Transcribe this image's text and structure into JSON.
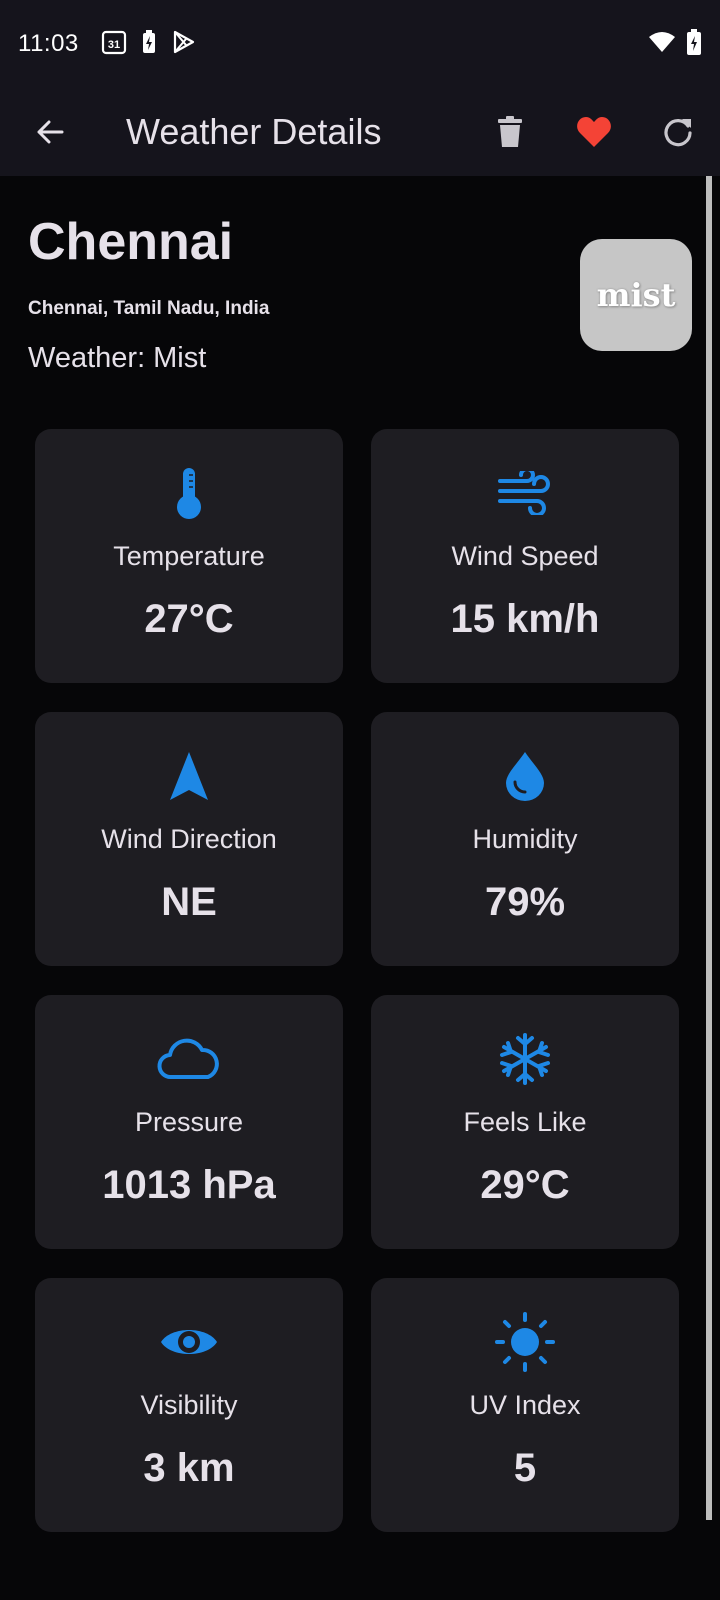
{
  "status_bar": {
    "time": "11:03",
    "calendar_day": "31"
  },
  "app_bar": {
    "title": "Weather Details"
  },
  "location": {
    "city": "Chennai",
    "full": "Chennai, Tamil Nadu, India",
    "weather_prefix": "Weather:",
    "weather": "Mist",
    "badge_text": "mist"
  },
  "cards": [
    {
      "label": "Temperature",
      "value": "27°C",
      "icon": "thermometer-icon"
    },
    {
      "label": "Wind Speed",
      "value": "15 km/h",
      "icon": "wind-icon"
    },
    {
      "label": "Wind Direction",
      "value": "NE",
      "icon": "navigation-arrow-icon"
    },
    {
      "label": "Humidity",
      "value": "79%",
      "icon": "water-drop-icon"
    },
    {
      "label": "Pressure",
      "value": "1013 hPa",
      "icon": "cloud-icon"
    },
    {
      "label": "Feels Like",
      "value": "29°C",
      "icon": "snowflake-icon"
    },
    {
      "label": "Visibility",
      "value": "3 km",
      "icon": "eye-icon"
    },
    {
      "label": "UV Index",
      "value": "5",
      "icon": "sun-icon"
    }
  ],
  "colors": {
    "accent": "#1e88e5",
    "favorite": "#f44336",
    "card_bg": "#1e1d22",
    "bar_bg": "#15141c"
  }
}
